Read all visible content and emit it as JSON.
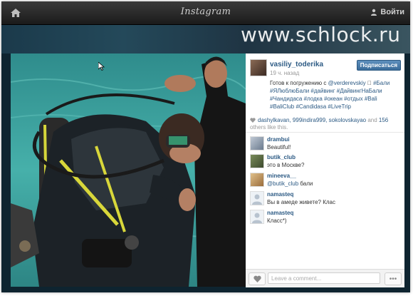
{
  "topbar": {
    "brand": "Instagram",
    "login_label": "Войти"
  },
  "watermark": "www.schlock.ru",
  "post": {
    "username": "vasiliy_toderika",
    "time": "19 ч. назад",
    "follow_label": "Подписаться",
    "caption_start": "Готов к погружению с ",
    "caption_mention": "@verderevskiy",
    "caption_emoji": "🏻",
    "caption_tags": "#Бали #ЯЛюблюБали #дайвинг #ДайвингНаБали #Чандидаса #лодка #океан #отдых #Bali #BaliClub #Candidasa #LiveTrip",
    "likes_users": "dashylkavan, 999indira999, sokolovskayao",
    "likes_and": " and ",
    "likes_count": "156",
    "likes_suffix": "others like this."
  },
  "comments": [
    {
      "user": "drambui",
      "text": "Beautiful!"
    },
    {
      "user": "butik_club",
      "text": "это в Москве?"
    },
    {
      "user": "mineeva__",
      "mention": "@butik_club",
      "text": " бали"
    },
    {
      "user": "namasteq",
      "text": "Вы в амеде живете? Клас"
    },
    {
      "user": "namasteq",
      "text": "Класс*)"
    }
  ],
  "comment_box": {
    "placeholder": "Leave a comment...",
    "more_label": "•••"
  },
  "colors": {
    "link": "#2c5a84",
    "topbar": "#1b1b1b",
    "follow_button": "#3a6c9a"
  }
}
